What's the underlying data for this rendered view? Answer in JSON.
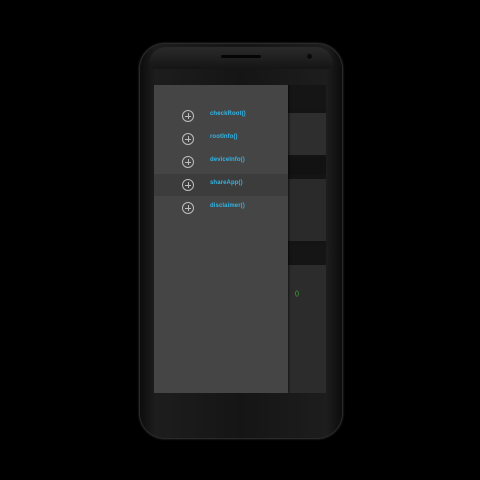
{
  "drawer": {
    "items": [
      {
        "label": "checkRoot()",
        "icon": "plus-circle-icon"
      },
      {
        "label": "rootInfo()",
        "icon": "plus-circle-icon"
      },
      {
        "label": "deviceInfo()",
        "icon": "plus-circle-icon"
      },
      {
        "label": "shareApp()",
        "icon": "plus-circle-icon"
      },
      {
        "label": "disclaimer()",
        "icon": "plus-circle-icon"
      }
    ],
    "active_index": 3
  },
  "background_app": {
    "status_text": "()"
  },
  "colors": {
    "link": "#33b5e5",
    "drawer_bg": "#454545",
    "status_green": "#3ac73a"
  }
}
